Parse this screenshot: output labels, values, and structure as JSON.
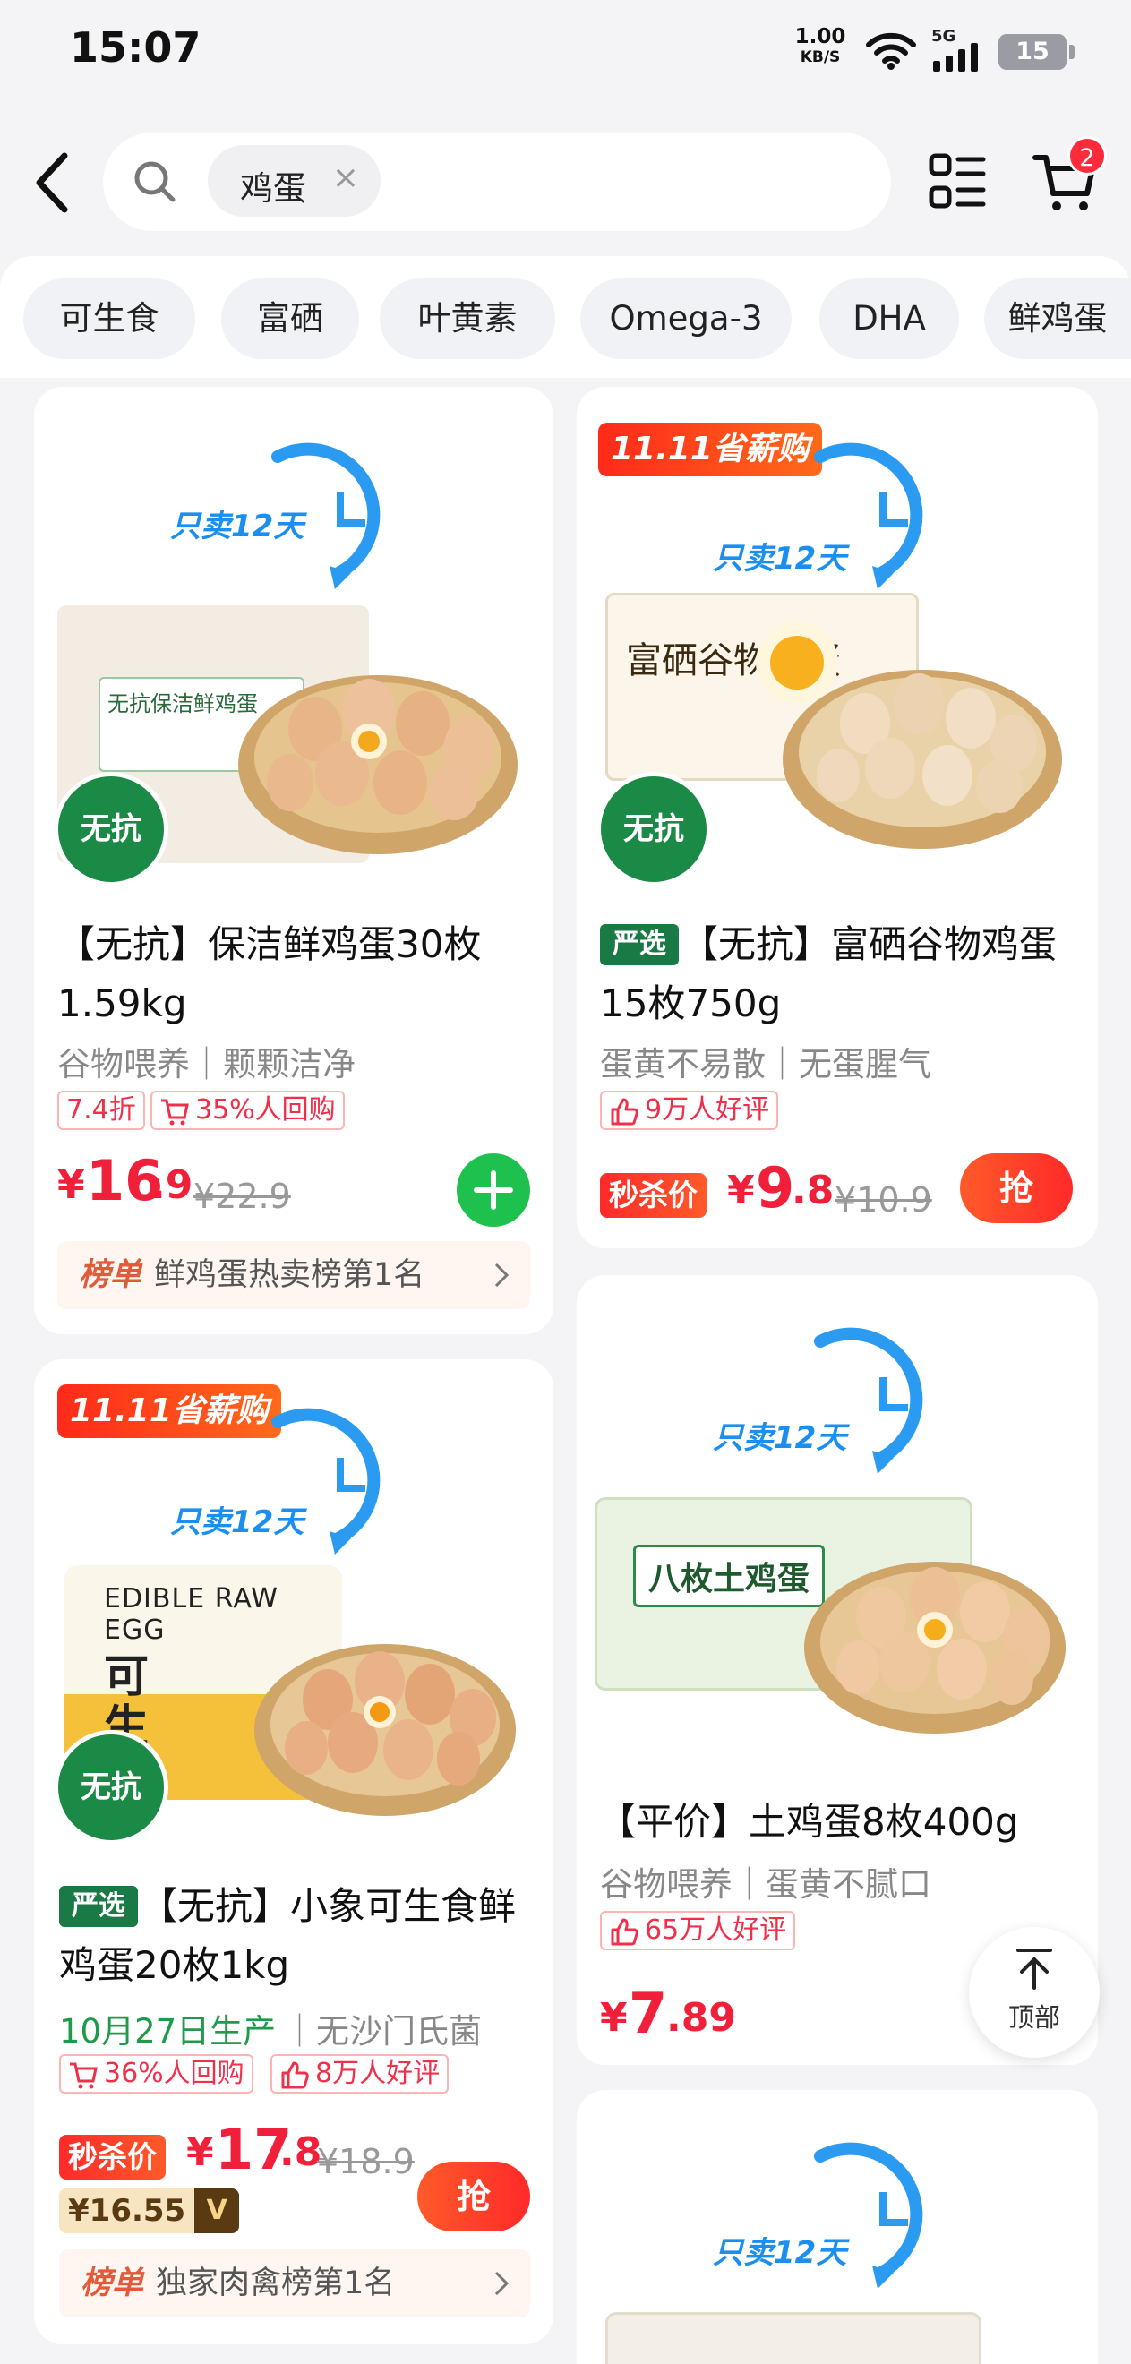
{
  "status_bar": {
    "time": "15:07",
    "net_speed_value": "1.00",
    "net_speed_unit": "KB/S",
    "network": "5G",
    "battery": "15"
  },
  "search": {
    "query": "鸡蛋",
    "clear_icon": "×",
    "cart_count": "2"
  },
  "filters": [
    "可生食",
    "富硒",
    "叶黄素",
    "Omega-3",
    "DHA",
    "鲜鸡蛋"
  ],
  "colors": {
    "price_red": "#f0203a",
    "accent_green": "#1fc14e",
    "brand_blue": "#1b8ff0"
  },
  "products": [
    {
      "promo_text": "只卖12天",
      "title": "【无抗】保洁鲜鸡蛋30枚1.59kg",
      "title_line1": "【无抗】保洁鲜鸡蛋30枚",
      "title_line2": "1.59kg",
      "subtitle": "谷物喂养｜颗颗洁净",
      "tags": [
        "7.4折",
        "35%人回购"
      ],
      "currency": "¥",
      "price_int": "16",
      "price_dec": ".9",
      "original_price": "¥22.9",
      "rank_label": "榜单",
      "rank_text": "鲜鸡蛋热卖榜第1名",
      "no_antibiotic_badge": "无抗",
      "package_text": "无抗保洁鲜鸡蛋"
    },
    {
      "event_label": "11.11省薪购",
      "promo_text": "只卖12天",
      "brand_badge": "严选",
      "title_line1": "【无抗】富硒谷物鸡蛋",
      "title_line2": "15枚750g",
      "subtitle": "蛋黄不易散｜无蛋腥气",
      "tags": [
        "9万人好评"
      ],
      "sale_label": "秒杀价",
      "currency": "¥",
      "price_int": "9",
      "price_dec": ".8",
      "original_price": "¥10.9",
      "grab_label": "抢",
      "no_antibiotic_badge": "无抗",
      "package_text": "富硒谷物鸡蛋"
    },
    {
      "event_label": "11.11省薪购",
      "promo_text": "只卖12天",
      "brand_badge": "严选",
      "title_line1": "【无抗】小象可生食鲜",
      "title_line2": "鸡蛋20枚1kg",
      "production_date": "10月27日生产",
      "subtitle_rest": "｜无沙门氏菌",
      "tags": [
        "36%人回购",
        "8万人好评"
      ],
      "sale_label": "秒杀价",
      "currency": "¥",
      "price_int": "17",
      "price_dec": ".8",
      "original_price": "¥18.9",
      "member_price": "¥16.55",
      "member_icon": "V",
      "grab_label": "抢",
      "rank_label": "榜单",
      "rank_text": "独家肉禽榜第1名",
      "no_antibiotic_badge": "无抗",
      "package_text": "EDIBLE RAW EGG",
      "package_big": "可生食"
    },
    {
      "promo_text": "只卖12天",
      "title_line1": "【平价】土鸡蛋8枚400g",
      "subtitle": "谷物喂养｜蛋黄不腻口",
      "tags": [
        "65万人好评"
      ],
      "currency": "¥",
      "price_int": "7",
      "price_dec": ".89",
      "package_text": "八枚土鸡蛋"
    },
    {
      "promo_text": "只卖12天"
    }
  ],
  "back_to_top": "顶部"
}
